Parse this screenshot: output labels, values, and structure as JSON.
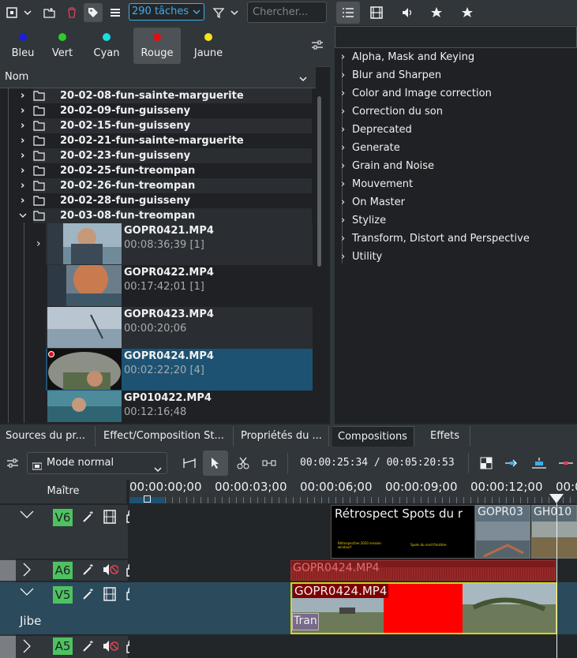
{
  "bin_toolbar": {
    "task_count": "290 tâches",
    "search_placeholder": "Chercher..."
  },
  "color_filters": [
    {
      "label": "Bleu",
      "color": "#1d1dd6"
    },
    {
      "label": "Vert",
      "color": "#2bcc2b"
    },
    {
      "label": "Cyan",
      "color": "#18dede"
    },
    {
      "label": "Rouge",
      "color": "#e01010"
    },
    {
      "label": "Jaune",
      "color": "#f5e51a"
    }
  ],
  "tree": {
    "column_header": "Nom",
    "folders": [
      "20-02-08-fun-sainte-marguerite",
      "20-02-09-fun-guisseny",
      "20-02-15-fun-guisseny",
      "20-02-21-fun-sainte-marguerite",
      "20-02-23-fun-guisseny",
      "20-02-25-fun-treompan",
      "20-02-26-fun-treompan",
      "20-02-28-fun-guisseny",
      "20-03-08-fun-treompan"
    ],
    "clips": [
      {
        "name": "GOPR0421.MP4",
        "duration": "00:08:36;39 [1]"
      },
      {
        "name": "GOPR0422.MP4",
        "duration": "00:17:42;01 [1]"
      },
      {
        "name": "GOPR0423.MP4",
        "duration": "00:00:20;06"
      },
      {
        "name": "GOPR0424.MP4",
        "duration": "00:02:22;20 [4]"
      },
      {
        "name": "GP010422.MP4",
        "duration": "00:12:16;48"
      }
    ]
  },
  "effects": [
    "Alpha, Mask and Keying",
    "Blur and Sharpen",
    "Color and Image correction",
    "Correction du son",
    "Deprecated",
    "Generate",
    "Grain and Noise",
    "Mouvement",
    "On Master",
    "Stylize",
    "Transform, Distort and Perspective",
    "Utility"
  ],
  "tabs": [
    "Sources du pr...",
    "Effect/Composition St...",
    "Propriétés du ...",
    "Compositions",
    "Effets"
  ],
  "timeline": {
    "mode": "Mode normal",
    "timecode": "00:00:25:34 / 00:05:20:53",
    "master_label": "Maître",
    "ruler": [
      "00:00:00;00",
      "00:00:03;00",
      "00:00:06;00",
      "00:00:09;00",
      "00:00:12;00",
      "00:0"
    ],
    "tracks": [
      {
        "tag": "V6",
        "name": ""
      },
      {
        "tag": "A6",
        "name": ""
      },
      {
        "tag": "V5",
        "name": "Jibe"
      },
      {
        "tag": "A5",
        "name": ""
      }
    ],
    "clips": {
      "v6_title": "Rétrospect Spots du r",
      "v6_clip2": "GOPR03",
      "v6_clip3": "GH010",
      "v6_small_left": "Rétrospective 2020 session windsurf",
      "v6_small_right": "Spots du nord finistère",
      "a6_clip": "GOPR0424.MP4",
      "v5_clip": "GOPR0424.MP4",
      "v5_transition": "Tran"
    }
  }
}
